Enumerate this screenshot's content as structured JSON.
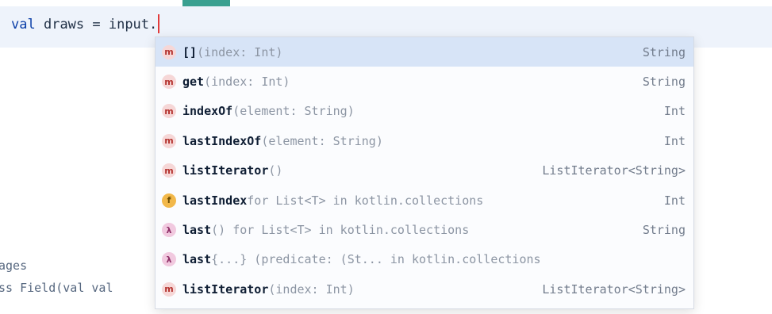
{
  "editor": {
    "code_keyword": "val",
    "code_rest": "draws = input.",
    "background_lines": [
      "ages",
      "ss Field(val val"
    ]
  },
  "completion": {
    "items": [
      {
        "icon": "method",
        "icon_letter": "m",
        "name": "[]",
        "tail": "(index: Int)",
        "type": "String",
        "selected": true
      },
      {
        "icon": "method",
        "icon_letter": "m",
        "name": "get",
        "tail": "(index: Int)",
        "type": "String"
      },
      {
        "icon": "method",
        "icon_letter": "m",
        "name": "indexOf",
        "tail": "(element: String)",
        "type": "Int"
      },
      {
        "icon": "method",
        "icon_letter": "m",
        "name": "lastIndexOf",
        "tail": "(element: String)",
        "type": "Int"
      },
      {
        "icon": "method",
        "icon_letter": "m",
        "name": "listIterator",
        "tail": "()",
        "type": "ListIterator<String>"
      },
      {
        "icon": "field",
        "icon_letter": "f",
        "name": "lastIndex",
        "tail": " for List<T> in kotlin.collections",
        "type": "Int"
      },
      {
        "icon": "lambda",
        "icon_letter": "λ",
        "name": "last",
        "tail": "() for List<T> in kotlin.collections",
        "type": "String"
      },
      {
        "icon": "lambda",
        "icon_letter": "λ",
        "name": "last",
        "tail": " {...} (predicate: (St... in kotlin.collections",
        "type": ""
      },
      {
        "icon": "method",
        "icon_letter": "m",
        "name": "listIterator",
        "tail": "(index: Int)",
        "type": "ListIterator<String>"
      }
    ]
  }
}
